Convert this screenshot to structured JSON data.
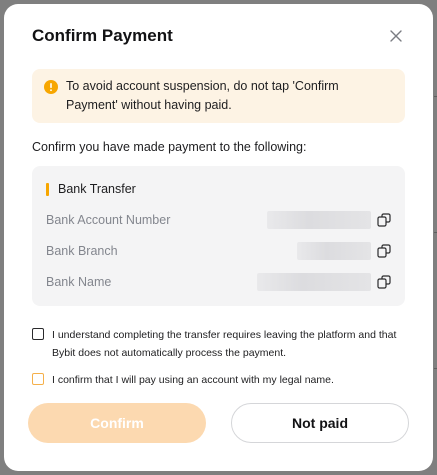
{
  "modal": {
    "title": "Confirm Payment",
    "warning": "To avoid account suspension, do not tap 'Confirm Payment' without having paid.",
    "lead": "Confirm you have made payment to the following:"
  },
  "bank": {
    "title": "Bank Transfer",
    "rows": [
      {
        "label": "Bank Account Number"
      },
      {
        "label": "Bank Branch"
      },
      {
        "label": "Bank Name"
      }
    ]
  },
  "checks": [
    {
      "text": "I understand completing the transfer requires leaving the platform and that Bybit does not automatically process the payment.",
      "checked": false
    },
    {
      "text": "I confirm that I will pay using an account with my legal name.",
      "checked": false
    }
  ],
  "buttons": {
    "confirm": "Confirm",
    "not_paid": "Not paid"
  },
  "colors": {
    "accent": "#f7a600",
    "confirm_disabled": "#fcd9b0",
    "warning_bg": "#fdf3e4"
  }
}
